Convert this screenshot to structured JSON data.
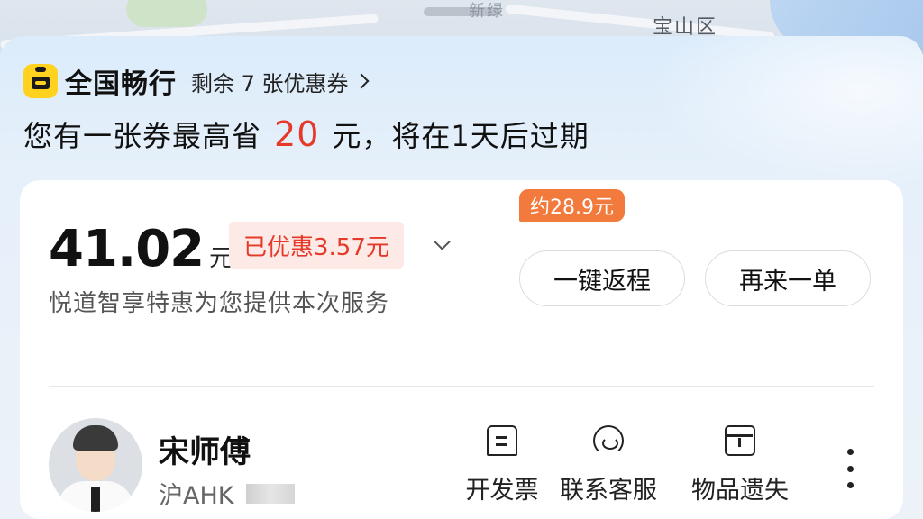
{
  "map": {
    "district_label": "宝山区",
    "faint_label": "新绿"
  },
  "promo": {
    "brand_name": "全国畅行",
    "coupon_link": "剩余 7 张优惠券",
    "headline_prefix": "您有一张券最高省",
    "headline_amount": "20",
    "headline_suffix": "元，将在1天后过期",
    "accent_color": "#e53a2a",
    "brand_color": "#ffd21f"
  },
  "fare": {
    "amount": "41.02",
    "unit": "元",
    "discount_label": "已优惠3.57元",
    "service_text": "悦道智享特惠为您提供本次服务"
  },
  "actions": {
    "return_estimate": "约28.9元",
    "return_button": "一键返程",
    "again_button": "再来一单"
  },
  "driver": {
    "name": "宋师傅",
    "plate": "沪AHK"
  },
  "quick_actions": [
    {
      "label": "开发票",
      "icon": "receipt-icon"
    },
    {
      "label": "联系客服",
      "icon": "headset-icon"
    },
    {
      "label": "物品遗失",
      "icon": "lost-item-icon"
    }
  ]
}
